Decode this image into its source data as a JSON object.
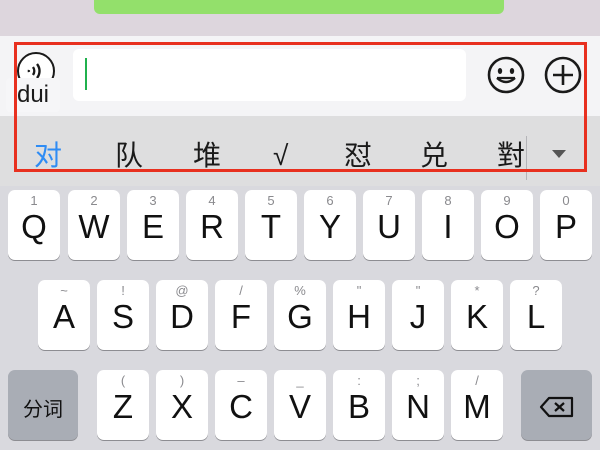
{
  "input": {
    "value": ""
  },
  "pinyin": "dui",
  "candidates": [
    "对",
    "队",
    "堆",
    "√",
    "怼",
    "兑",
    "對"
  ],
  "keyboard": {
    "row1": [
      {
        "sub": "1",
        "main": "Q"
      },
      {
        "sub": "2",
        "main": "W"
      },
      {
        "sub": "3",
        "main": "E"
      },
      {
        "sub": "4",
        "main": "R"
      },
      {
        "sub": "5",
        "main": "T"
      },
      {
        "sub": "6",
        "main": "Y"
      },
      {
        "sub": "7",
        "main": "U"
      },
      {
        "sub": "8",
        "main": "I"
      },
      {
        "sub": "9",
        "main": "O"
      },
      {
        "sub": "0",
        "main": "P"
      }
    ],
    "row2": [
      {
        "sub": "~",
        "main": "A"
      },
      {
        "sub": "!",
        "main": "S"
      },
      {
        "sub": "@",
        "main": "D"
      },
      {
        "sub": "/",
        "main": "F"
      },
      {
        "sub": "%",
        "main": "G"
      },
      {
        "sub": "\"",
        "main": "H"
      },
      {
        "sub": "\"",
        "main": "J"
      },
      {
        "sub": "*",
        "main": "K"
      },
      {
        "sub": "?",
        "main": "L"
      }
    ],
    "row3": [
      {
        "sub": "(",
        "main": "Z"
      },
      {
        "sub": ")",
        "main": "X"
      },
      {
        "sub": "–",
        "main": "C"
      },
      {
        "sub": "_",
        "main": "V"
      },
      {
        "sub": ":",
        "main": "B"
      },
      {
        "sub": ";",
        "main": "N"
      },
      {
        "sub": "/",
        "main": "M"
      }
    ],
    "segment_label": "分词"
  },
  "colors": {
    "active_candidate": "#2f8cf4",
    "highlight_border": "#e8301f",
    "caret": "#20b14d"
  },
  "icons": [
    "voice-icon",
    "emoji-icon",
    "plus-icon",
    "expand-candidates-icon",
    "delete-icon"
  ]
}
